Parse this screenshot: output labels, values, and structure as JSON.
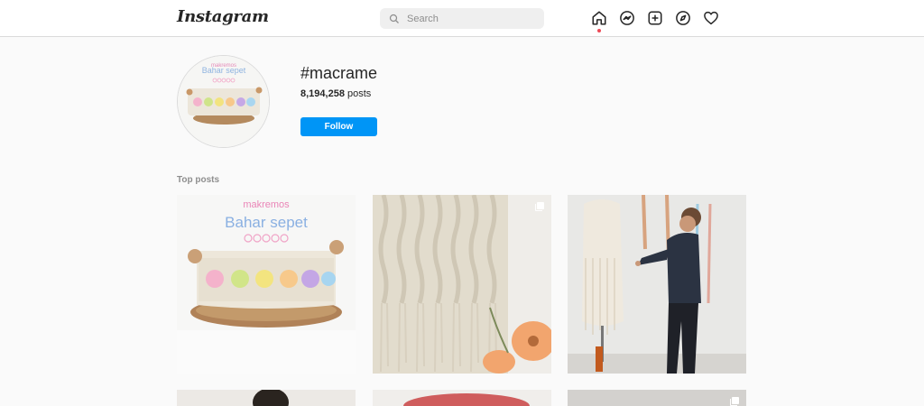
{
  "header": {
    "logo": "Instagram",
    "search_placeholder": "Search",
    "nav": [
      "home-icon",
      "messenger-icon",
      "new-post-icon",
      "explore-icon",
      "activity-icon"
    ]
  },
  "hashtag": {
    "title": "#macrame",
    "post_count": "8,194,258",
    "posts_label": "posts",
    "follow_label": "Follow",
    "avatar_caption": "Bahar sepet",
    "avatar_caption_top": "makremos"
  },
  "section": {
    "label": "Top posts"
  },
  "posts": [
    {
      "caption_top": "makremos",
      "caption": "Bahar sepet",
      "multi": false
    },
    {
      "multi": true
    },
    {
      "multi": false
    }
  ],
  "colors": {
    "accent": "#0095f6",
    "notification": "#ed4956",
    "border": "#dbdbdb",
    "background": "#fafafa"
  }
}
